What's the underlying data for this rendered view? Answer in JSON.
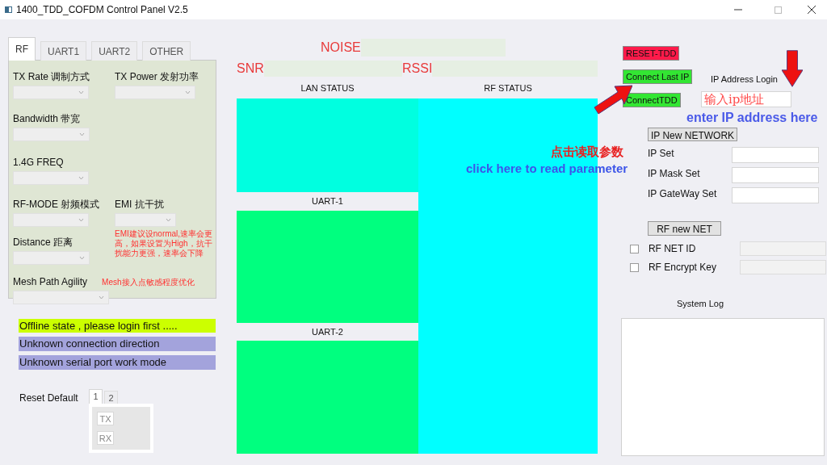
{
  "window": {
    "title": "1400_TDD_COFDM Control Panel V2.5"
  },
  "tabs": [
    {
      "label": "RF",
      "selected": true
    },
    {
      "label": "UART1",
      "selected": false
    },
    {
      "label": "UART2",
      "selected": false
    },
    {
      "label": "OTHER",
      "selected": false
    }
  ],
  "rf_panel": {
    "rows": [
      [
        {
          "label": "TX Rate 调制方式"
        },
        {
          "label": "TX Power 发射功率"
        }
      ],
      [
        {
          "label": "Bandwidth 带宽"
        }
      ],
      [
        {
          "label": "1.4G  FREQ"
        }
      ],
      [
        {
          "label": "RF-MODE 射频模式"
        },
        {
          "label": "EMI 抗干扰",
          "note": "EMI建议设normal,速率会更高，如果设置为High，抗干扰能力更强，速率会下降"
        }
      ],
      [
        {
          "label": "Distance 距离"
        }
      ],
      [
        {
          "label": "Mesh Path Agility",
          "inline_note": "Mesh接入点敏感程度优化"
        }
      ]
    ]
  },
  "status_lines": [
    {
      "text": "Offline state , please login first .....",
      "color": "#ccff00"
    },
    {
      "text": "Unknown connection direction",
      "color": "#a3a3dc"
    },
    {
      "text": "Unknown serial port work mode",
      "color": "#a3a3dc"
    }
  ],
  "reset_default": {
    "label": "Reset Default",
    "tabs": [
      {
        "label": "1",
        "selected": true
      },
      {
        "label": "2",
        "selected": false
      }
    ],
    "buttons": [
      "TX",
      "RX"
    ]
  },
  "readouts": {
    "noise": "NOISE",
    "snr": "SNR",
    "rssi": "RSSI"
  },
  "status_panels": {
    "lan": "LAN STATUS",
    "rf": "RF STATUS",
    "uart1": "UART-1",
    "uart2": "UART-2"
  },
  "buttons": [
    {
      "label": "RESET-TDD",
      "color": "#ff1a4a"
    },
    {
      "label": "Connect Last IP",
      "color": "#33e633"
    },
    {
      "label": "ConnectTDD",
      "color": "#33e633"
    }
  ],
  "login": {
    "label": "IP Address Login",
    "value": "输入ip地址"
  },
  "annotations": {
    "enter_ip": "enter IP address here",
    "read_cn": "点击读取参数",
    "read_en": "click here to read parameter"
  },
  "network": {
    "button": "IP New NETWORK",
    "fields": [
      {
        "label": "IP Set"
      },
      {
        "label": "IP Mask Set"
      },
      {
        "label": "IP GateWay Set"
      }
    ]
  },
  "rf_net": {
    "button": "RF new NET",
    "options": [
      {
        "label": "RF NET ID",
        "checked": false
      },
      {
        "label": "RF Encrypt Key",
        "checked": false
      }
    ]
  },
  "system_log": {
    "label": "System Log"
  }
}
